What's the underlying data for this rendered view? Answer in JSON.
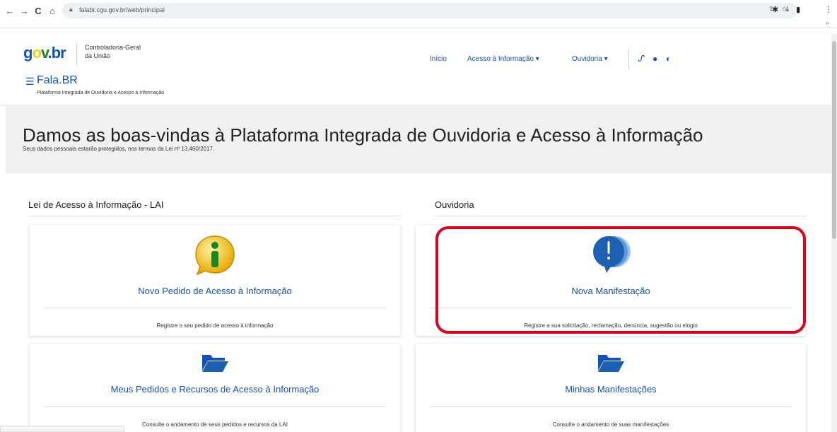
{
  "browser": {
    "url": "falabr.cgu.gov.br/web/principal",
    "nav": {
      "back": "←",
      "forward": "→",
      "reload": "C",
      "home": "⌂"
    }
  },
  "header": {
    "logo": {
      "g": "g",
      "o": "o",
      "v": "v",
      "br": ".br"
    },
    "org_line1": "Controladoria-Geral",
    "org_line2": "da União",
    "brand": "Fala.BR",
    "brand_sub": "Plataforma Integrada de Ouvidoria e Acesso à Informação",
    "nav": {
      "inicio": "Início",
      "acesso": "Acesso à Informação ▾",
      "ouvidoria": "Ouvidoria ▾"
    }
  },
  "welcome": {
    "title": "Damos as boas-vindas à Plataforma Integrada de Ouvidoria e Acesso à Informação",
    "subtitle": "Seus dados pessoais estarão protegidos, nos termos da Lei nº 13.460/2017."
  },
  "sections": {
    "lai": "Lei de Acesso à Informação - LAI",
    "ouvidoria": "Ouvidoria"
  },
  "cards": {
    "novo_pedido": {
      "title": "Novo Pedido de Acesso à Informação",
      "desc": "Registre o seu pedido de acesso à informação"
    },
    "nova_manifestacao": {
      "title": "Nova Manifestação",
      "desc": "Registre a sua solicitação, reclamação, denúncia, sugestão ou elogio"
    },
    "meus_pedidos": {
      "title": "Meus Pedidos e Recursos de Acesso à Informação",
      "desc": "Consulte o andamento de seus pedidos e recursos da LAI"
    },
    "minhas_manifestacoes": {
      "title": "Minhas Manifestações",
      "desc": "Consulte o andamento de suas manifestações"
    }
  },
  "colors": {
    "primary": "#1351b4",
    "highlight": "#e0001b",
    "info_yellow": "#ffcd07",
    "info_green": "#168821"
  }
}
